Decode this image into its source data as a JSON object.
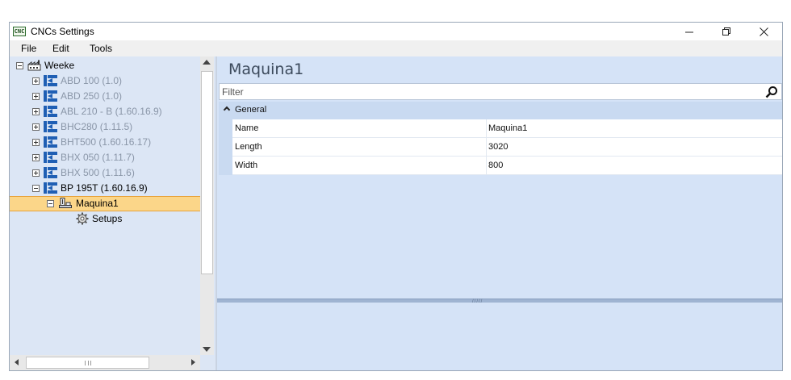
{
  "window": {
    "app_icon_text": "CNC",
    "title": "CNCs Settings",
    "controls": {
      "minimize": "—",
      "maximize": "❐",
      "close": "✕"
    }
  },
  "menu": {
    "items": [
      "File",
      "Edit",
      "Tools"
    ]
  },
  "tree": {
    "root": {
      "label": "Weeke",
      "icon": "factory-icon",
      "expanded": true
    },
    "cncs": [
      {
        "label": "ABD 100 (1.0)",
        "expanded": false,
        "dim": true
      },
      {
        "label": "ABD 250 (1.0)",
        "expanded": false,
        "dim": true
      },
      {
        "label": "ABL 210 - B (1.60.16.9)",
        "expanded": false,
        "dim": true
      },
      {
        "label": "BHC280 (1.11.5)",
        "expanded": false,
        "dim": true
      },
      {
        "label": "BHT500 (1.60.16.17)",
        "expanded": false,
        "dim": true
      },
      {
        "label": "BHX 050 (1.11.7)",
        "expanded": false,
        "dim": true
      },
      {
        "label": "BHX 500 (1.11.6)",
        "expanded": false,
        "dim": true
      },
      {
        "label": "BP 195T (1.60.16.9)",
        "expanded": true,
        "dim": false
      }
    ],
    "machine": {
      "label": "Maquina1",
      "selected": true,
      "icon": "machine-icon"
    },
    "setups": {
      "label": "Setups",
      "icon": "gear-icon"
    }
  },
  "details": {
    "title": "Maquina1",
    "filter_placeholder": "Filter",
    "category": "General",
    "properties": [
      {
        "name": "Name",
        "value": "Maquina1"
      },
      {
        "name": "Length",
        "value": "3020"
      },
      {
        "name": "Width",
        "value": "800"
      }
    ],
    "splitter_grip": "/////"
  },
  "colors": {
    "panel_bg": "#d5e3f7",
    "tree_bg": "#dce6f5",
    "selection": "#fbd689",
    "cnc_icon": "#1f5fb4"
  }
}
